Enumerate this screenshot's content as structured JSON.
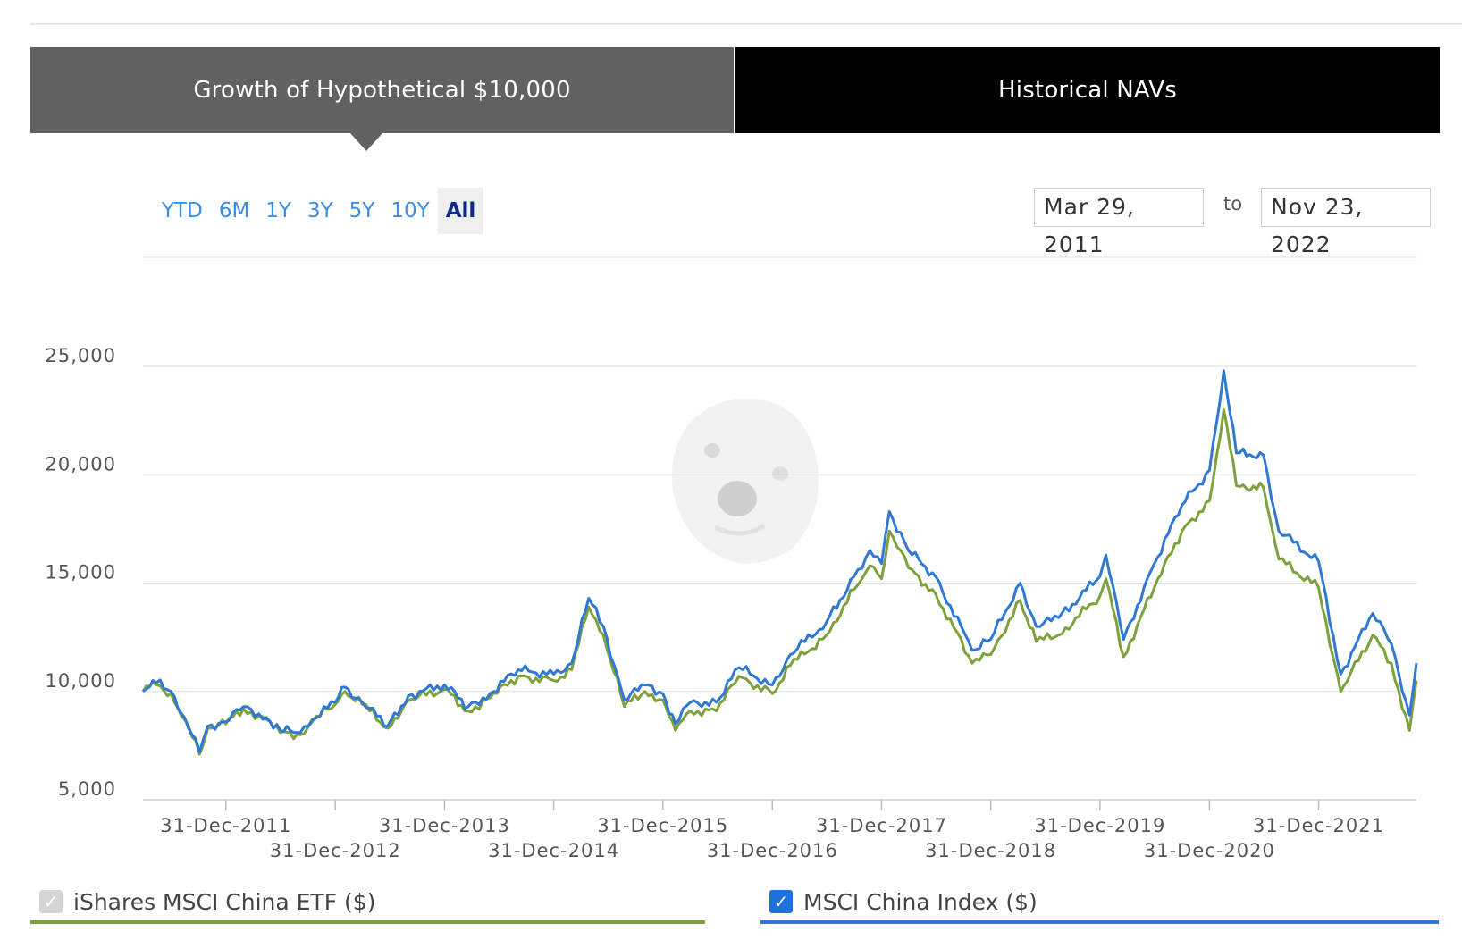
{
  "tabs": [
    {
      "label": "Growth of Hypothetical $10,000",
      "active": true
    },
    {
      "label": "Historical NAVs",
      "active": false
    }
  ],
  "range_buttons": [
    "YTD",
    "6M",
    "1Y",
    "3Y",
    "5Y",
    "10Y",
    "All"
  ],
  "range_selected": "All",
  "date_range": {
    "from": "Mar 29, 2011",
    "separator": "to",
    "to": "Nov 23, 2022"
  },
  "legend": {
    "etf": {
      "label": "iShares MSCI China ETF ($)",
      "checked": false,
      "color": "#7da13c"
    },
    "index": {
      "label": "MSCI China Index ($)",
      "checked": true,
      "color": "#2f79d4"
    }
  },
  "chart_data": {
    "type": "line",
    "xlabel": "",
    "ylabel": "",
    "x_range": [
      "2011-03-29",
      "2022-11-23"
    ],
    "ylim": [
      5000,
      25000
    ],
    "y_ticks": [
      5000,
      10000,
      15000,
      20000,
      25000
    ],
    "y_tick_labels": [
      "5,000",
      "10,000",
      "15,000",
      "20,000",
      "25,000"
    ],
    "x_ticks": [
      "2011-12-31",
      "2012-12-31",
      "2013-12-31",
      "2014-12-31",
      "2015-12-31",
      "2016-12-31",
      "2017-12-31",
      "2018-12-31",
      "2019-12-31",
      "2020-12-31",
      "2021-12-31"
    ],
    "x_tick_labels": [
      "31-Dec-2011",
      "31-Dec-2012",
      "31-Dec-2013",
      "31-Dec-2014",
      "31-Dec-2015",
      "31-Dec-2016",
      "31-Dec-2017",
      "31-Dec-2018",
      "31-Dec-2019",
      "31-Dec-2020",
      "31-Dec-2021"
    ],
    "grid": true,
    "series": [
      {
        "name": "iShares MSCI China ETF ($)",
        "color": "#7da13c",
        "points": [
          [
            "2011-03-29",
            10000
          ],
          [
            "2011-05-01",
            10400
          ],
          [
            "2011-07-01",
            9900
          ],
          [
            "2011-08-15",
            8700
          ],
          [
            "2011-10-04",
            7100
          ],
          [
            "2011-11-01",
            8300
          ],
          [
            "2011-12-31",
            8500
          ],
          [
            "2012-02-28",
            9200
          ],
          [
            "2012-05-15",
            8700
          ],
          [
            "2012-06-30",
            8100
          ],
          [
            "2012-09-05",
            8000
          ],
          [
            "2012-10-15",
            8600
          ],
          [
            "2012-12-31",
            9400
          ],
          [
            "2013-02-01",
            10000
          ],
          [
            "2013-03-31",
            9400
          ],
          [
            "2013-06-24",
            8300
          ],
          [
            "2013-09-01",
            9600
          ],
          [
            "2013-12-31",
            10100
          ],
          [
            "2014-03-20",
            9100
          ],
          [
            "2014-06-01",
            9700
          ],
          [
            "2014-09-03",
            10700
          ],
          [
            "2014-12-31",
            10500
          ],
          [
            "2015-03-01",
            11000
          ],
          [
            "2015-04-27",
            13900
          ],
          [
            "2015-06-15",
            12600
          ],
          [
            "2015-08-24",
            9300
          ],
          [
            "2015-11-01",
            10000
          ],
          [
            "2015-12-31",
            9600
          ],
          [
            "2016-02-11",
            8200
          ],
          [
            "2016-04-01",
            9100
          ],
          [
            "2016-06-27",
            9100
          ],
          [
            "2016-09-10",
            10700
          ],
          [
            "2016-12-31",
            9900
          ],
          [
            "2017-03-01",
            11200
          ],
          [
            "2017-06-30",
            12600
          ],
          [
            "2017-09-30",
            14700
          ],
          [
            "2017-11-22",
            15800
          ],
          [
            "2017-12-31",
            15200
          ],
          [
            "2018-01-26",
            17400
          ],
          [
            "2018-03-31",
            15700
          ],
          [
            "2018-06-30",
            14500
          ],
          [
            "2018-10-30",
            11300
          ],
          [
            "2018-12-31",
            11700
          ],
          [
            "2019-04-08",
            14200
          ],
          [
            "2019-06-01",
            12300
          ],
          [
            "2019-08-15",
            12600
          ],
          [
            "2019-12-31",
            14400
          ],
          [
            "2020-01-20",
            15200
          ],
          [
            "2020-03-19",
            11600
          ],
          [
            "2020-06-30",
            14800
          ],
          [
            "2020-09-30",
            17400
          ],
          [
            "2020-12-31",
            18800
          ],
          [
            "2021-02-17",
            23000
          ],
          [
            "2021-03-31",
            19500
          ],
          [
            "2021-06-30",
            19400
          ],
          [
            "2021-08-20",
            16100
          ],
          [
            "2021-12-31",
            14800
          ],
          [
            "2022-03-15",
            10000
          ],
          [
            "2022-06-30",
            12600
          ],
          [
            "2022-08-31",
            11300
          ],
          [
            "2022-10-31",
            8200
          ],
          [
            "2022-11-23",
            10500
          ]
        ]
      },
      {
        "name": "MSCI China Index ($)",
        "color": "#2f79d4",
        "points": [
          [
            "2011-03-29",
            10000
          ],
          [
            "2011-05-01",
            10500
          ],
          [
            "2011-07-01",
            10000
          ],
          [
            "2011-08-15",
            8800
          ],
          [
            "2011-10-04",
            7200
          ],
          [
            "2011-11-01",
            8400
          ],
          [
            "2011-12-31",
            8600
          ],
          [
            "2012-02-28",
            9300
          ],
          [
            "2012-05-15",
            8800
          ],
          [
            "2012-06-30",
            8200
          ],
          [
            "2012-09-05",
            8100
          ],
          [
            "2012-10-15",
            8700
          ],
          [
            "2012-12-31",
            9500
          ],
          [
            "2013-02-01",
            10200
          ],
          [
            "2013-03-31",
            9500
          ],
          [
            "2013-06-24",
            8400
          ],
          [
            "2013-09-01",
            9800
          ],
          [
            "2013-12-31",
            10300
          ],
          [
            "2014-03-20",
            9300
          ],
          [
            "2014-06-01",
            9900
          ],
          [
            "2014-09-03",
            11000
          ],
          [
            "2014-12-31",
            10800
          ],
          [
            "2015-03-01",
            11300
          ],
          [
            "2015-04-27",
            14300
          ],
          [
            "2015-06-15",
            13000
          ],
          [
            "2015-08-24",
            9600
          ],
          [
            "2015-11-01",
            10300
          ],
          [
            "2015-12-31",
            9900
          ],
          [
            "2016-02-11",
            8500
          ],
          [
            "2016-04-01",
            9500
          ],
          [
            "2016-06-27",
            9500
          ],
          [
            "2016-09-10",
            11100
          ],
          [
            "2016-12-31",
            10300
          ],
          [
            "2017-03-01",
            11700
          ],
          [
            "2017-06-30",
            13200
          ],
          [
            "2017-09-30",
            15300
          ],
          [
            "2017-11-22",
            16500
          ],
          [
            "2017-12-31",
            15900
          ],
          [
            "2018-01-26",
            18300
          ],
          [
            "2018-03-31",
            16500
          ],
          [
            "2018-06-30",
            15300
          ],
          [
            "2018-10-30",
            11900
          ],
          [
            "2018-12-31",
            12400
          ],
          [
            "2019-04-08",
            15000
          ],
          [
            "2019-06-01",
            13000
          ],
          [
            "2019-08-15",
            13400
          ],
          [
            "2019-12-31",
            15300
          ],
          [
            "2020-01-20",
            16300
          ],
          [
            "2020-03-19",
            12400
          ],
          [
            "2020-06-30",
            15900
          ],
          [
            "2020-09-30",
            18600
          ],
          [
            "2020-12-31",
            20200
          ],
          [
            "2021-02-17",
            24800
          ],
          [
            "2021-03-31",
            21000
          ],
          [
            "2021-06-30",
            20900
          ],
          [
            "2021-08-20",
            17400
          ],
          [
            "2021-12-31",
            16000
          ],
          [
            "2022-03-15",
            10800
          ],
          [
            "2022-06-30",
            13600
          ],
          [
            "2022-08-31",
            12200
          ],
          [
            "2022-10-31",
            8900
          ],
          [
            "2022-11-23",
            11300
          ]
        ]
      }
    ]
  }
}
